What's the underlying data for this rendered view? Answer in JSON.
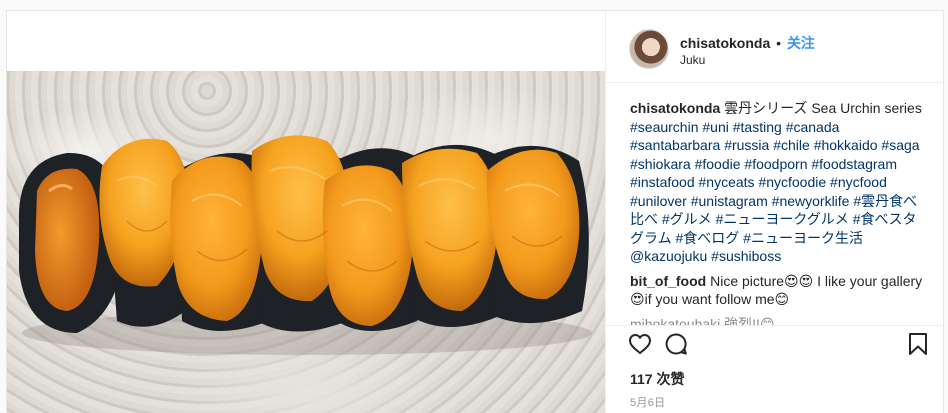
{
  "post": {
    "username": "chisatokonda",
    "separator": "•",
    "follow_label": "关注",
    "location": "Juku"
  },
  "caption": {
    "username": "chisatokonda",
    "parts": [
      {
        "text": " 雲丹シリーズ Sea Urchin series ",
        "tag": false
      },
      {
        "text": "#seaurchin",
        "tag": true
      },
      {
        "text": " ",
        "tag": false
      },
      {
        "text": "#uni",
        "tag": true
      },
      {
        "text": " ",
        "tag": false
      },
      {
        "text": "#tasting",
        "tag": true
      },
      {
        "text": " ",
        "tag": false
      },
      {
        "text": "#canada",
        "tag": true
      },
      {
        "text": " ",
        "tag": false
      },
      {
        "text": "#santabarbara",
        "tag": true
      },
      {
        "text": " ",
        "tag": false
      },
      {
        "text": "#russia",
        "tag": true
      },
      {
        "text": " ",
        "tag": false
      },
      {
        "text": "#chile",
        "tag": true
      },
      {
        "text": " ",
        "tag": false
      },
      {
        "text": "#hokkaido",
        "tag": true
      },
      {
        "text": " ",
        "tag": false
      },
      {
        "text": "#saga",
        "tag": true
      },
      {
        "text": " ",
        "tag": false
      },
      {
        "text": "#shiokara",
        "tag": true
      },
      {
        "text": " ",
        "tag": false
      },
      {
        "text": "#foodie",
        "tag": true
      },
      {
        "text": " ",
        "tag": false
      },
      {
        "text": "#foodporn",
        "tag": true
      },
      {
        "text": " ",
        "tag": false
      },
      {
        "text": "#foodstagram",
        "tag": true
      },
      {
        "text": " ",
        "tag": false
      },
      {
        "text": "#instafood",
        "tag": true
      },
      {
        "text": " ",
        "tag": false
      },
      {
        "text": "#nyceats",
        "tag": true
      },
      {
        "text": " ",
        "tag": false
      },
      {
        "text": "#nycfoodie",
        "tag": true
      },
      {
        "text": " ",
        "tag": false
      },
      {
        "text": "#nycfood",
        "tag": true
      },
      {
        "text": " ",
        "tag": false
      },
      {
        "text": "#unilover",
        "tag": true
      },
      {
        "text": " ",
        "tag": false
      },
      {
        "text": "#unistagram",
        "tag": true
      },
      {
        "text": " ",
        "tag": false
      },
      {
        "text": "#newyorklife",
        "tag": true
      },
      {
        "text": " ",
        "tag": false
      },
      {
        "text": "#雲丹食べ比べ",
        "tag": true
      },
      {
        "text": " ",
        "tag": false
      },
      {
        "text": "#グルメ",
        "tag": true
      },
      {
        "text": " ",
        "tag": false
      },
      {
        "text": "#ニューヨークグルメ",
        "tag": true
      },
      {
        "text": " ",
        "tag": false
      },
      {
        "text": "#食べスタグラム",
        "tag": true
      },
      {
        "text": " ",
        "tag": false
      },
      {
        "text": "#食べログ",
        "tag": true
      },
      {
        "text": " ",
        "tag": false
      },
      {
        "text": "#ニューヨーク生活",
        "tag": true
      },
      {
        "text": " ",
        "tag": false
      },
      {
        "text": "@kazuojuku",
        "tag": true
      },
      {
        "text": " ",
        "tag": false
      },
      {
        "text": "#sushiboss",
        "tag": true
      }
    ]
  },
  "comment1": {
    "username": "bit_of_food",
    "text": " Nice picture😍😍 I like your gallery 😍if you want follow me😊"
  },
  "comment2": {
    "text": "mihokatouhaki 強烈!!😊"
  },
  "stats": {
    "likes": "117 次赞",
    "date": "5月6日"
  },
  "icons": [
    "heart-icon",
    "comment-icon",
    "bookmark-icon"
  ],
  "colors": {
    "accent": "#3897f0",
    "hashtag": "#003569",
    "border": "#efefef"
  }
}
